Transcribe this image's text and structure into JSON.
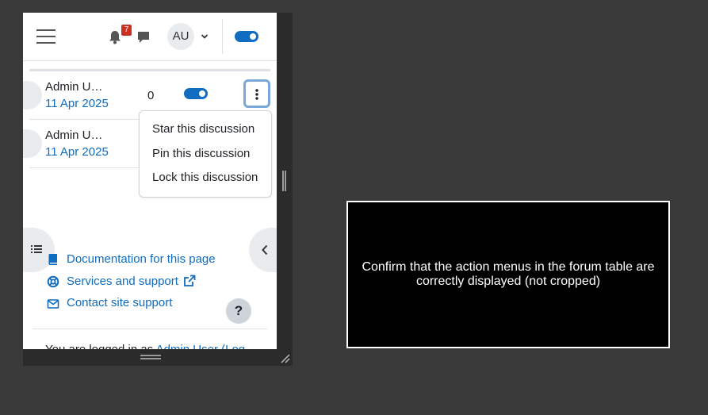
{
  "navbar": {
    "notification_count": "7",
    "avatar_initials": "AU",
    "edit_mode_on": true
  },
  "discussions": [
    {
      "author": "Admin U…",
      "date": "11 Apr 2025",
      "replies": "0",
      "subscribed": true
    },
    {
      "author": "Admin U…",
      "date": "11 Apr 2025"
    }
  ],
  "action_menu": {
    "items": [
      "Star this discussion",
      "Pin this discussion",
      "Lock this discussion"
    ]
  },
  "footer": {
    "documentation": "Documentation for this page",
    "services": "Services and support",
    "contact": "Contact site support",
    "help": "?",
    "logged_in_prefix": "You are logged in as ",
    "logged_in_user": "Admin User (Log"
  },
  "instruction": {
    "text": "Confirm that the action menus in the forum table are correctly displayed (not cropped)"
  },
  "colors": {
    "accent": "#0f6cbf",
    "badge": "#ca3120",
    "background": "#393939"
  },
  "icons": [
    "hamburger-icon",
    "bell-icon",
    "chat-icon",
    "chevron-down-icon",
    "kebab-icon",
    "list-icon",
    "chevron-left-icon",
    "book-icon",
    "lifebuoy-icon",
    "external-link-icon",
    "envelope-icon",
    "resize-handle-icon"
  ]
}
